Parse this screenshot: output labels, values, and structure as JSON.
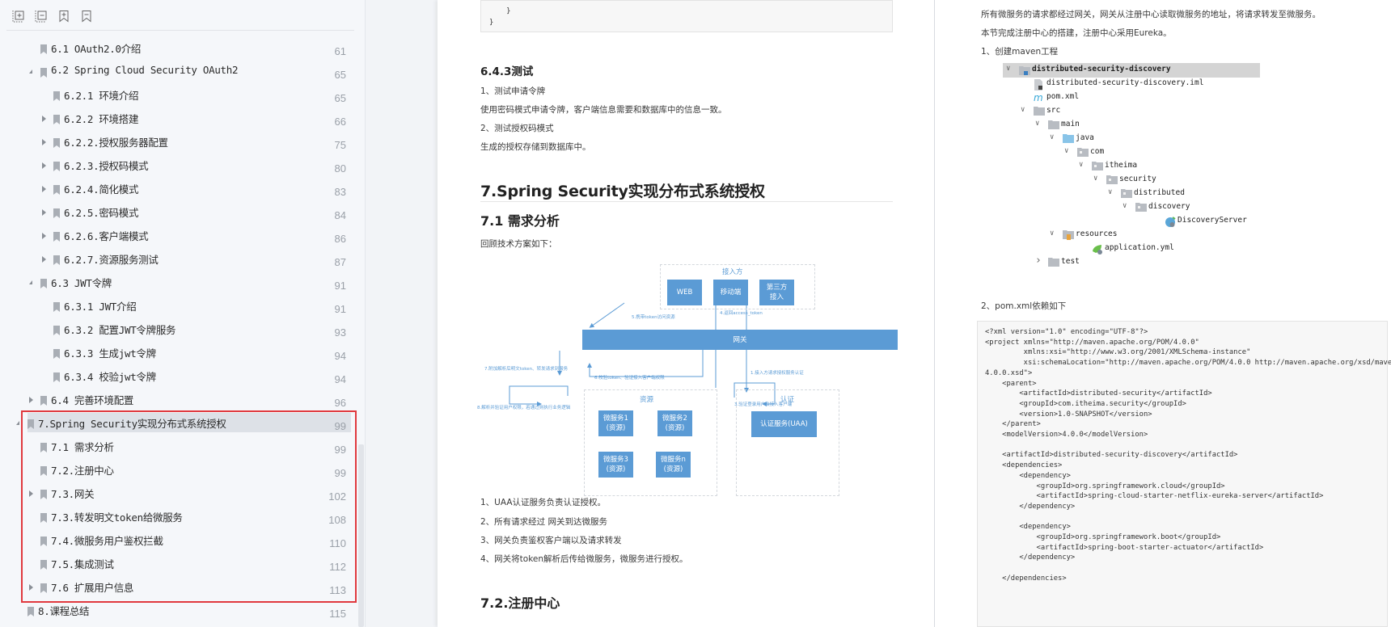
{
  "toolbar": {
    "buttons": [
      {
        "name": "expand-all",
        "icon": "expand-all-icon"
      },
      {
        "name": "collapse-all",
        "icon": "collapse-all-icon"
      },
      {
        "name": "add-bookmark",
        "icon": "bookmark-add-icon"
      },
      {
        "name": "remove-bookmark",
        "icon": "bookmark-remove-icon"
      }
    ]
  },
  "toc": {
    "items": [
      {
        "label": "6.1 OAuth2.0介绍",
        "page": "61",
        "level": 1,
        "toggle": "none"
      },
      {
        "label": "6.2 Spring Cloud Security OAuth2",
        "page": "65",
        "level": 1,
        "toggle": "expanded"
      },
      {
        "label": "6.2.1 环境介绍",
        "page": "65",
        "level": 2,
        "toggle": "none"
      },
      {
        "label": "6.2.2 环境搭建",
        "page": "66",
        "level": 2,
        "toggle": "collapsed"
      },
      {
        "label": "6.2.2.授权服务器配置",
        "page": "75",
        "level": 2,
        "toggle": "collapsed"
      },
      {
        "label": "6.2.3.授权码模式",
        "page": "80",
        "level": 2,
        "toggle": "collapsed"
      },
      {
        "label": "6.2.4.简化模式",
        "page": "83",
        "level": 2,
        "toggle": "collapsed"
      },
      {
        "label": "6.2.5.密码模式",
        "page": "84",
        "level": 2,
        "toggle": "collapsed"
      },
      {
        "label": "6.2.6.客户端模式",
        "page": "86",
        "level": 2,
        "toggle": "collapsed"
      },
      {
        "label": "6.2.7.资源服务测试",
        "page": "87",
        "level": 2,
        "toggle": "collapsed"
      },
      {
        "label": "6.3 JWT令牌",
        "page": "91",
        "level": 1,
        "toggle": "expanded"
      },
      {
        "label": "6.3.1 JWT介绍",
        "page": "91",
        "level": 2,
        "toggle": "none"
      },
      {
        "label": "6.3.2 配置JWT令牌服务",
        "page": "93",
        "level": 2,
        "toggle": "none"
      },
      {
        "label": "6.3.3 生成jwt令牌",
        "page": "94",
        "level": 2,
        "toggle": "none"
      },
      {
        "label": "6.3.4 校验jwt令牌",
        "page": "94",
        "level": 2,
        "toggle": "none"
      },
      {
        "label": "6.4 完善环境配置",
        "page": "96",
        "level": 1,
        "toggle": "collapsed"
      },
      {
        "label": "7.Spring Security实现分布式系统授权",
        "page": "99",
        "level": 0,
        "toggle": "expanded",
        "selected": true
      },
      {
        "label": "7.1 需求分析",
        "page": "99",
        "level": 1,
        "toggle": "none"
      },
      {
        "label": "7.2.注册中心",
        "page": "99",
        "level": 1,
        "toggle": "none"
      },
      {
        "label": "7.3.网关",
        "page": "102",
        "level": 1,
        "toggle": "collapsed"
      },
      {
        "label": "7.3.转发明文token给微服务",
        "page": "108",
        "level": 1,
        "toggle": "none"
      },
      {
        "label": "7.4.微服务用户鉴权拦截",
        "page": "110",
        "level": 1,
        "toggle": "none"
      },
      {
        "label": "7.5.集成测试",
        "page": "112",
        "level": 1,
        "toggle": "none"
      },
      {
        "label": "7.6 扩展用户信息",
        "page": "113",
        "level": 1,
        "toggle": "collapsed"
      },
      {
        "label": "8.课程总结",
        "page": "115",
        "level": 0,
        "toggle": "none"
      }
    ],
    "highlight_color": "#e0393e"
  },
  "page_left": {
    "code_tail": [
      "    }",
      "}"
    ],
    "h_643": "6.4.3测试",
    "p1": "1、测试申请令牌",
    "p2": "使用密码模式申请令牌，客户端信息需要和数据库中的信息一致。",
    "p3": "2、测试授权码模式",
    "p4": "生成的授权存储到数据库中。",
    "h_7": "7.Spring Security实现分布式系统授权",
    "h_71": "7.1 需求分析",
    "p5": "回顾技术方案如下：",
    "diagram": {
      "group_client": "接入方",
      "web": "WEB",
      "mobile": "移动端",
      "third_party": "第三方\n接入",
      "gateway": "网关",
      "group_resource": "资源",
      "group_auth": "认证",
      "ms1": "微服务1\n(资源)",
      "ms2": "微服务2\n(资源)",
      "ms3": "微服务3\n(资源)",
      "msn": "微服务n\n(资源)",
      "uaa": "认证服务(UAA)",
      "step1": "1.接入方请求授权服务认证",
      "step3": "3.验证登录用户及接入客户端",
      "step4": "4.返回access_token",
      "step5": "5.携带token访问资源",
      "step6": "6.校验token、验证接入客户端权限",
      "step7": "7.附加解析后明文token、转发请求到服务",
      "step8": "8.解析并验证用户权限，若通过则执行业务逻辑",
      "accent": "#5b9bd5"
    },
    "list": [
      "1、UAA认证服务负责认证授权。",
      "2、所有请求经过 网关到达微服务",
      "3、网关负责鉴权客户端以及请求转发",
      "4、网关将token解析后传给微服务，微服务进行授权。"
    ],
    "h_72": "7.2.注册中心"
  },
  "page_right": {
    "p1": "所有微服务的请求都经过网关，网关从注册中心读取微服务的地址，将请求转发至微服务。",
    "p2": "本节完成注册中心的搭建，注册中心采用Eureka。",
    "p3": "1、创建maven工程",
    "tree": [
      {
        "label": "distributed-security-discovery",
        "depth": 0,
        "chev": "down",
        "icon": "module-folder",
        "selected": true
      },
      {
        "label": "distributed-security-discovery.iml",
        "depth": 1,
        "chev": "",
        "icon": "iml-file"
      },
      {
        "label": "pom.xml",
        "depth": 1,
        "chev": "",
        "icon": "maven-file"
      },
      {
        "label": "src",
        "depth": 1,
        "chev": "down",
        "icon": "folder"
      },
      {
        "label": "main",
        "depth": 2,
        "chev": "down",
        "icon": "folder"
      },
      {
        "label": "java",
        "depth": 3,
        "chev": "down",
        "icon": "source-folder"
      },
      {
        "label": "com",
        "depth": 4,
        "chev": "down",
        "icon": "package"
      },
      {
        "label": "itheima",
        "depth": 5,
        "chev": "down",
        "icon": "package"
      },
      {
        "label": "security",
        "depth": 6,
        "chev": "down",
        "icon": "package"
      },
      {
        "label": "distributed",
        "depth": 7,
        "chev": "down",
        "icon": "package"
      },
      {
        "label": "discovery",
        "depth": 8,
        "chev": "down",
        "icon": "package"
      },
      {
        "label": "DiscoveryServer",
        "depth": 10,
        "chev": "",
        "icon": "spring-class"
      },
      {
        "label": "resources",
        "depth": 3,
        "chev": "down",
        "icon": "resources-folder"
      },
      {
        "label": "application.yml",
        "depth": 5,
        "chev": "",
        "icon": "spring-yml"
      },
      {
        "label": "test",
        "depth": 2,
        "chev": "right",
        "icon": "folder"
      }
    ],
    "p4": "2、pom.xml依赖如下",
    "code": [
      "<?xml version=\"1.0\" encoding=\"UTF-8\"?>",
      "<project xmlns=\"http://maven.apache.org/POM/4.0.0\"",
      "         xmlns:xsi=\"http://www.w3.org/2001/XMLSchema-instance\"",
      "         xsi:schemaLocation=\"http://maven.apache.org/POM/4.0.0 http://maven.apache.org/xsd/maven-",
      "4.0.0.xsd\">",
      "    <parent>",
      "        <artifactId>distributed-security</artifactId>",
      "        <groupId>com.itheima.security</groupId>",
      "        <version>1.0-SNAPSHOT</version>",
      "    </parent>",
      "    <modelVersion>4.0.0</modelVersion>",
      "",
      "    <artifactId>distributed-security-discovery</artifactId>",
      "    <dependencies>",
      "        <dependency>",
      "            <groupId>org.springframework.cloud</groupId>",
      "            <artifactId>spring-cloud-starter-netflix-eureka-server</artifactId>",
      "        </dependency>",
      "",
      "        <dependency>",
      "            <groupId>org.springframework.boot</groupId>",
      "            <artifactId>spring-boot-starter-actuator</artifactId>",
      "        </dependency>",
      "",
      "    </dependencies>"
    ]
  }
}
